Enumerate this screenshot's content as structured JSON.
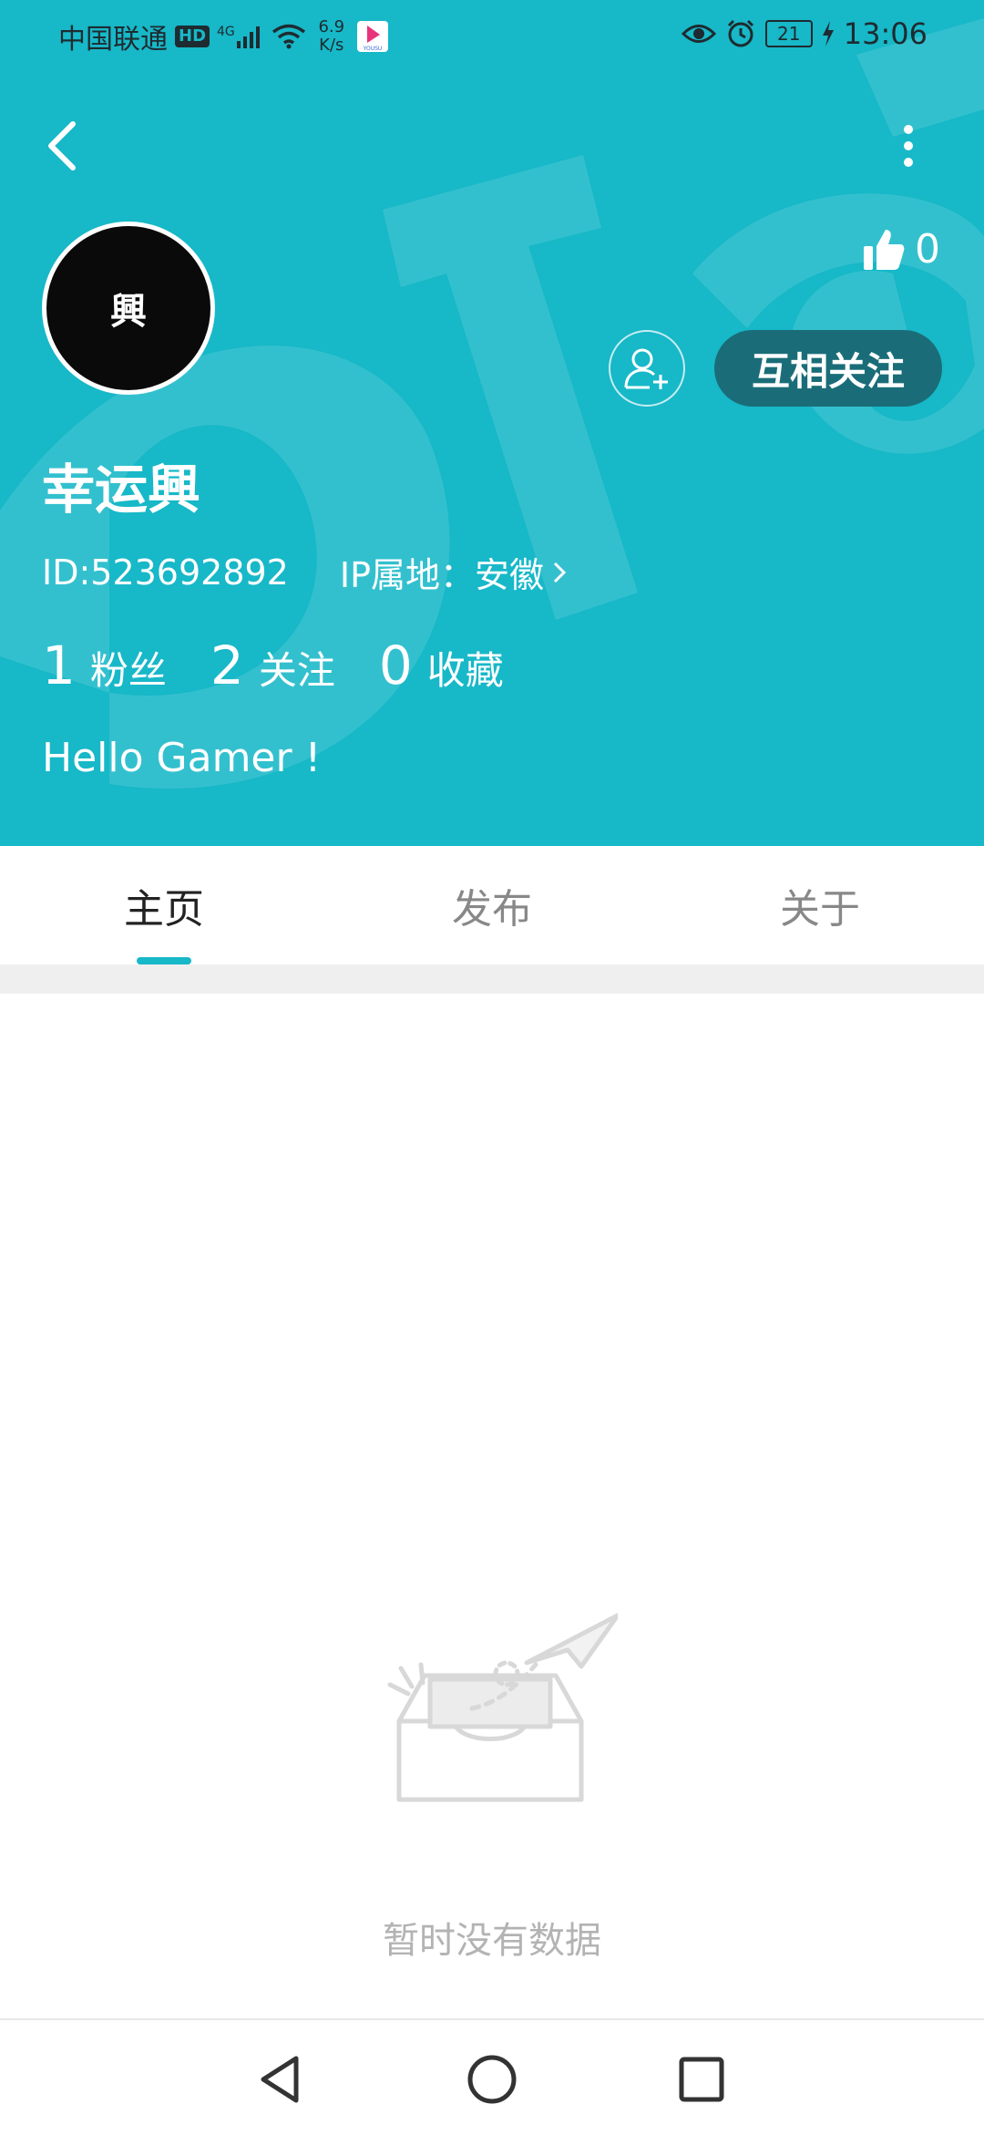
{
  "status_bar": {
    "carrier": "中国联通",
    "hd_badge": "HD",
    "network": "4G",
    "speed_value": "6.9",
    "speed_unit": "K/s",
    "app_badge": "YOUSU",
    "battery": "21",
    "time": "13:06"
  },
  "header": {
    "likes_count": "0",
    "avatar_char": "興",
    "follow_button": "互相关注",
    "username": "幸运興",
    "user_id": "ID:523692892",
    "ip_location": "IP属地：安徽",
    "stats": [
      {
        "num": "1",
        "label": "粉丝"
      },
      {
        "num": "2",
        "label": "关注"
      },
      {
        "num": "0",
        "label": "收藏"
      }
    ],
    "bio": "Hello Gamer !"
  },
  "tabs": [
    {
      "label": "主页",
      "active": true
    },
    {
      "label": "发布",
      "active": false
    },
    {
      "label": "关于",
      "active": false
    }
  ],
  "empty_state": {
    "message": "暂时没有数据"
  },
  "colors": {
    "header_bg": "#17b8c8",
    "follow_btn_bg": "#1a6d78",
    "accent": "#17b8c8"
  },
  "icons": [
    "back-icon",
    "more-icon",
    "thumbs-up-icon",
    "add-friend-icon",
    "nav-back-icon",
    "nav-home-icon",
    "nav-recents-icon"
  ]
}
